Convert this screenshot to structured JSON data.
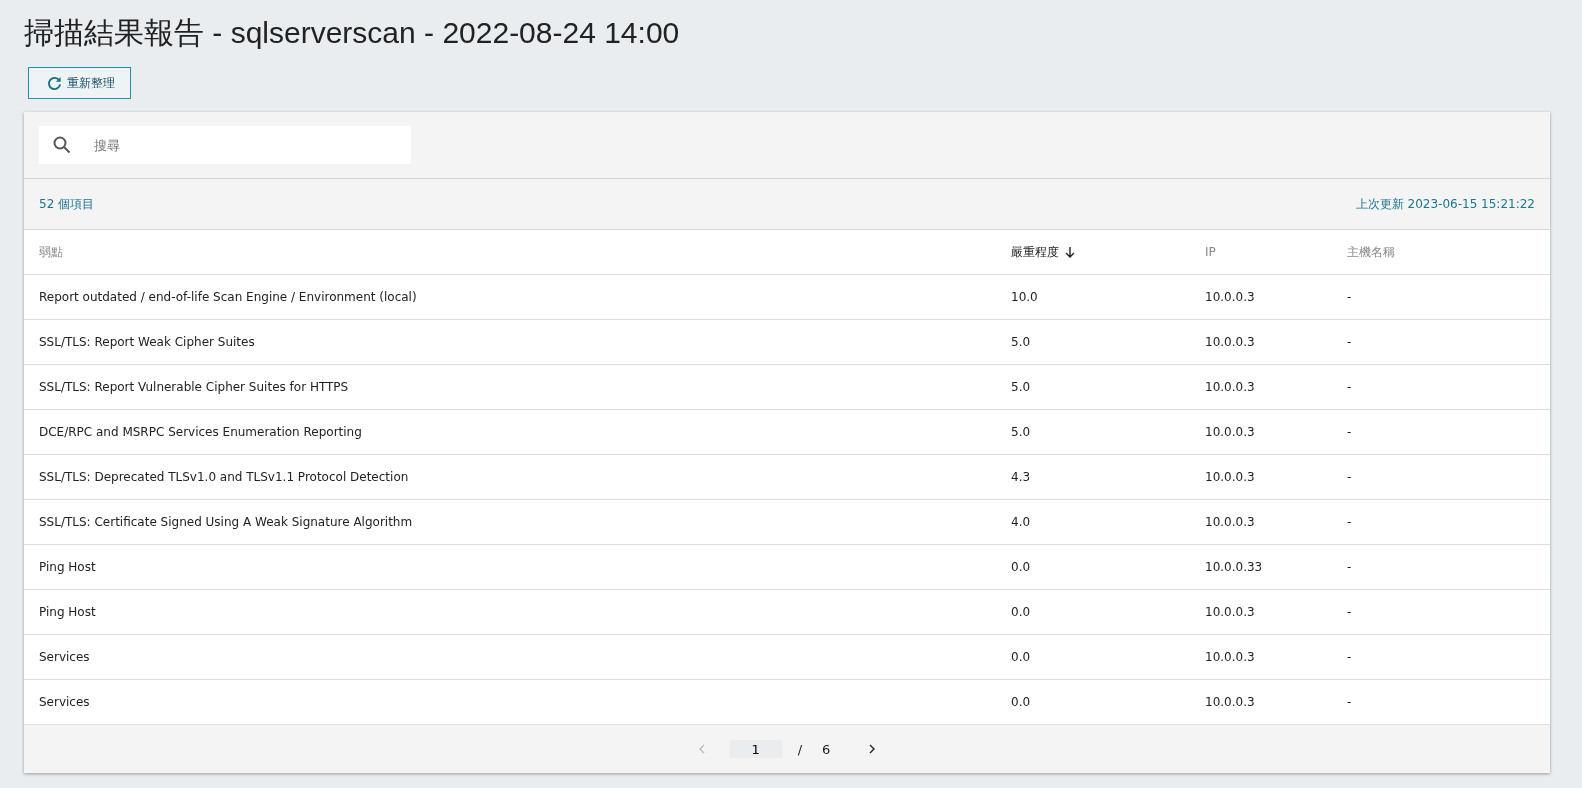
{
  "title": "掃描結果報告 - sqlserverscan - 2022-08-24 14:00",
  "refresh_button": {
    "label": "重新整理"
  },
  "search": {
    "placeholder": "搜尋"
  },
  "item_count": "52 個項目",
  "last_updated": "上次更新 2023-06-15 15:21:22",
  "table": {
    "columns": [
      {
        "label": "弱點",
        "sorted": false
      },
      {
        "label": "嚴重程度",
        "sorted": true
      },
      {
        "label": "IP",
        "sorted": false
      },
      {
        "label": "主機名稱",
        "sorted": false
      }
    ],
    "rows": [
      [
        "Report outdated / end-of-life Scan Engine / Environment (local)",
        "10.0",
        "10.0.0.3",
        "-"
      ],
      [
        "SSL/TLS: Report Weak Cipher Suites",
        "5.0",
        "10.0.0.3",
        "-"
      ],
      [
        "SSL/TLS: Report Vulnerable Cipher Suites for HTTPS",
        "5.0",
        "10.0.0.3",
        "-"
      ],
      [
        "DCE/RPC and MSRPC Services Enumeration Reporting",
        "5.0",
        "10.0.0.3",
        "-"
      ],
      [
        "SSL/TLS: Deprecated TLSv1.0 and TLSv1.1 Protocol Detection",
        "4.3",
        "10.0.0.3",
        "-"
      ],
      [
        "SSL/TLS: Certificate Signed Using A Weak Signature Algorithm",
        "4.0",
        "10.0.0.3",
        "-"
      ],
      [
        "Ping Host",
        "0.0",
        "10.0.0.33",
        "-"
      ],
      [
        "Ping Host",
        "0.0",
        "10.0.0.3",
        "-"
      ],
      [
        "Services",
        "0.0",
        "10.0.0.3",
        "-"
      ],
      [
        "Services",
        "0.0",
        "10.0.0.3",
        "-"
      ]
    ]
  },
  "pagination": {
    "previous": {
      "disabled": true
    },
    "page": "1",
    "separator": "/",
    "total": "6",
    "next": {
      "disabled": false
    }
  }
}
